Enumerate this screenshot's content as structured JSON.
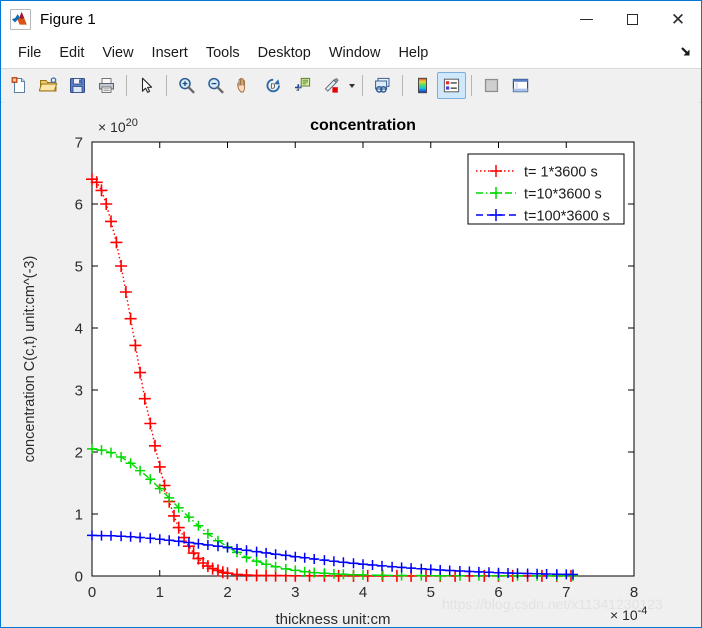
{
  "window": {
    "title": "Figure 1",
    "app_icon": "matlab-icon",
    "minimize_label": "Minimize",
    "maximize_label": "Maximize",
    "close_label": "Close"
  },
  "menu": {
    "items": [
      {
        "label": "File"
      },
      {
        "label": "Edit"
      },
      {
        "label": "View"
      },
      {
        "label": "Insert"
      },
      {
        "label": "Tools"
      },
      {
        "label": "Desktop"
      },
      {
        "label": "Window"
      },
      {
        "label": "Help"
      }
    ],
    "dock_control": "undock-arrow-icon"
  },
  "toolbar": {
    "buttons": [
      {
        "name": "new-figure-icon",
        "tip": "New Figure"
      },
      {
        "name": "open-file-icon",
        "tip": "Open File"
      },
      {
        "name": "save-figure-icon",
        "tip": "Save Figure"
      },
      {
        "name": "print-figure-icon",
        "tip": "Print Figure"
      },
      {
        "name": "pointer-icon",
        "tip": "Edit Plot"
      },
      {
        "name": "zoom-in-icon",
        "tip": "Zoom In"
      },
      {
        "name": "zoom-out-icon",
        "tip": "Zoom Out"
      },
      {
        "name": "pan-icon",
        "tip": "Pan"
      },
      {
        "name": "rotate-3d-icon",
        "tip": "Rotate 3D"
      },
      {
        "name": "data-cursor-icon",
        "tip": "Data Cursor"
      },
      {
        "name": "brush-icon",
        "tip": "Brush/Select Data"
      },
      {
        "name": "link-plot-icon",
        "tip": "Link Plot"
      },
      {
        "name": "colorbar-icon",
        "tip": "Insert Colorbar"
      },
      {
        "name": "legend-icon",
        "tip": "Insert Legend",
        "active": true
      },
      {
        "name": "hide-plot-tools-icon",
        "tip": "Hide Plot Tools"
      },
      {
        "name": "show-plot-tools-icon",
        "tip": "Show Plot Tools and Dock Figure"
      }
    ]
  },
  "chart_data": {
    "type": "line",
    "title": "concentration",
    "xlabel": "thickness   unit:cm",
    "ylabel": "concentration C(c,t)  unit:cm^(-3)",
    "x_exponent_label": "× 10",
    "x_exponent_value": "-4",
    "y_exponent_label": "× 10",
    "y_exponent_value": "20",
    "xlim": [
      0,
      8
    ],
    "ylim": [
      0,
      7
    ],
    "xticks": [
      0,
      1,
      2,
      3,
      4,
      5,
      6,
      7,
      8
    ],
    "yticks": [
      0,
      1,
      2,
      3,
      4,
      5,
      6,
      7
    ],
    "grid": false,
    "legend_position": "top-right",
    "watermark": "https://blog.csdn.net/x11341230123",
    "series": [
      {
        "name": "t= 1*3600 s",
        "color": "#ff0000",
        "linestyle": "dotted",
        "marker": "+",
        "x": [
          0.0,
          0.07,
          0.14,
          0.21,
          0.28,
          0.36,
          0.43,
          0.5,
          0.57,
          0.64,
          0.71,
          0.78,
          0.86,
          0.93,
          1.0,
          1.07,
          1.14,
          1.21,
          1.28,
          1.36,
          1.43,
          1.5,
          1.57,
          1.64,
          1.71,
          1.78,
          1.86,
          1.93,
          2.0,
          2.14,
          2.28,
          2.43,
          2.57,
          2.71,
          2.86,
          3.0,
          3.21,
          3.43,
          3.64,
          3.86,
          4.07,
          4.29,
          4.5,
          4.71,
          4.93,
          5.14,
          5.36,
          5.57,
          5.79,
          6.0,
          6.21,
          6.43,
          6.64,
          6.86,
          7.07
        ],
        "y": [
          6.4,
          6.35,
          6.22,
          6.0,
          5.72,
          5.38,
          5.0,
          4.58,
          4.15,
          3.72,
          3.28,
          2.86,
          2.46,
          2.1,
          1.76,
          1.46,
          1.2,
          0.97,
          0.78,
          0.62,
          0.48,
          0.37,
          0.28,
          0.21,
          0.16,
          0.12,
          0.09,
          0.06,
          0.045,
          0.025,
          0.015,
          0.01,
          0.008,
          0.006,
          0.005,
          0.004,
          0.003,
          0.003,
          0.002,
          0.002,
          0.002,
          0.002,
          0.002,
          0.002,
          0.002,
          0.002,
          0.002,
          0.002,
          0.002,
          0.002,
          0.002,
          0.002,
          0.002,
          0.002,
          0.002
        ]
      },
      {
        "name": "t=10*3600 s",
        "color": "#00d900",
        "linestyle": "dashdot",
        "marker": "+",
        "x": [
          0.0,
          0.14,
          0.28,
          0.43,
          0.57,
          0.71,
          0.86,
          1.0,
          1.14,
          1.28,
          1.43,
          1.57,
          1.71,
          1.86,
          2.0,
          2.14,
          2.28,
          2.43,
          2.57,
          2.71,
          2.86,
          3.0,
          3.14,
          3.28,
          3.43,
          3.57,
          3.71,
          3.86,
          4.0,
          4.28,
          4.57,
          4.86,
          5.14,
          5.43,
          5.71,
          6.0,
          6.28,
          6.57,
          6.86,
          7.1
        ],
        "y": [
          2.05,
          2.03,
          1.99,
          1.92,
          1.82,
          1.7,
          1.56,
          1.41,
          1.26,
          1.1,
          0.95,
          0.81,
          0.68,
          0.57,
          0.47,
          0.38,
          0.3,
          0.24,
          0.19,
          0.15,
          0.115,
          0.09,
          0.07,
          0.055,
          0.043,
          0.034,
          0.027,
          0.021,
          0.017,
          0.011,
          0.008,
          0.006,
          0.005,
          0.004,
          0.003,
          0.003,
          0.002,
          0.002,
          0.002,
          0.002
        ]
      },
      {
        "name": "t=100*3600 s",
        "color": "#0000ff",
        "linestyle": "dashed",
        "marker": "+",
        "x": [
          0.0,
          0.14,
          0.28,
          0.43,
          0.57,
          0.71,
          0.86,
          1.0,
          1.14,
          1.28,
          1.43,
          1.57,
          1.71,
          1.86,
          2.0,
          2.14,
          2.28,
          2.43,
          2.57,
          2.71,
          2.86,
          3.0,
          3.14,
          3.28,
          3.43,
          3.57,
          3.71,
          3.86,
          4.0,
          4.14,
          4.28,
          4.43,
          4.57,
          4.71,
          4.86,
          5.0,
          5.14,
          5.28,
          5.43,
          5.57,
          5.71,
          5.86,
          6.0,
          6.14,
          6.28,
          6.43,
          6.57,
          6.71,
          6.86,
          7.0,
          7.1
        ],
        "y": [
          0.655,
          0.652,
          0.648,
          0.641,
          0.632,
          0.621,
          0.608,
          0.593,
          0.577,
          0.559,
          0.54,
          0.521,
          0.5,
          0.479,
          0.458,
          0.437,
          0.415,
          0.394,
          0.373,
          0.352,
          0.332,
          0.312,
          0.293,
          0.274,
          0.256,
          0.239,
          0.222,
          0.206,
          0.191,
          0.177,
          0.163,
          0.15,
          0.138,
          0.127,
          0.116,
          0.106,
          0.097,
          0.088,
          0.08,
          0.073,
          0.066,
          0.06,
          0.054,
          0.049,
          0.044,
          0.04,
          0.036,
          0.032,
          0.029,
          0.026,
          0.024
        ]
      }
    ]
  }
}
